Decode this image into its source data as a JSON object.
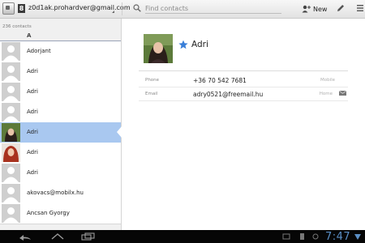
{
  "header": {
    "account": "z0d1ak.prohardver@gmail.com",
    "account_badge": "8",
    "search_placeholder": "Find contacts",
    "new_label": "New"
  },
  "list": {
    "count": "236 contacts",
    "section_letter": "A",
    "contacts": [
      {
        "name": "Adorjant",
        "photo": "none"
      },
      {
        "name": "Adri",
        "photo": "none"
      },
      {
        "name": "Adri",
        "photo": "none"
      },
      {
        "name": "Adri",
        "photo": "none"
      },
      {
        "name": "Adri",
        "photo": "dark-hair-green",
        "selected": true
      },
      {
        "name": "Adri",
        "photo": "red-hair"
      },
      {
        "name": "Adri",
        "photo": "none"
      },
      {
        "name": "akovacs@mobilx.hu",
        "photo": "none"
      },
      {
        "name": "Ancsan Gyorgy",
        "photo": "none"
      }
    ]
  },
  "detail": {
    "name": "Adri",
    "starred": true,
    "fields": [
      {
        "label": "Phone",
        "value": "+36 70 542 7681",
        "type": "Mobile"
      },
      {
        "label": "Email",
        "value": "adry0521@freemail.hu",
        "type": "Home",
        "action": "email-icon"
      }
    ]
  },
  "system_bar": {
    "time": "7:47"
  },
  "colors": {
    "selected_row": "#a9c8f0",
    "star": "#3a7fd8",
    "clock": "#5b8fc6"
  }
}
